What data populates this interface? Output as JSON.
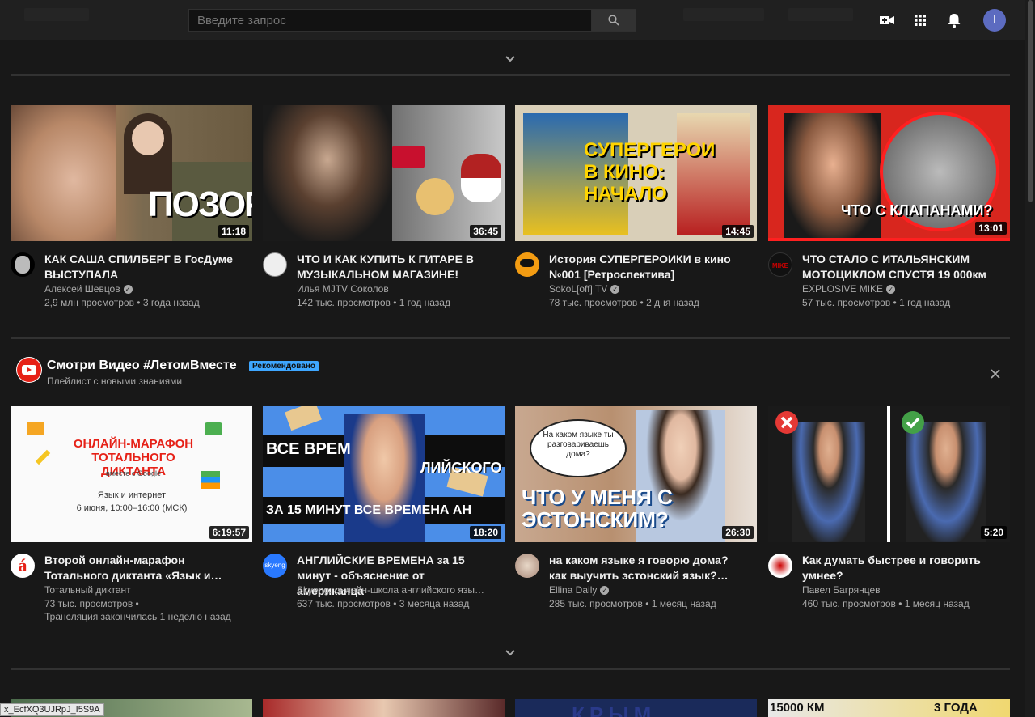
{
  "search": {
    "placeholder": "Введите запрос"
  },
  "avatar_letter": "I",
  "shelf": {
    "title": "Смотри Видео #ЛетомВместе",
    "badge": "Рекомендовано",
    "subtitle": "Плейлист с новыми знаниями"
  },
  "row1": [
    {
      "title": "КАК САША СПИЛБЕРГ В ГосДуме ВЫСТУПАЛА",
      "channel": "Алексей Шевцов",
      "verified": true,
      "stats": "2,9 млн просмотров • 3 года назад",
      "duration": "11:18",
      "overlay": "ПОЗОР"
    },
    {
      "title": "ЧТО И КАК КУПИТЬ К ГИТАРЕ В МУЗЫКАЛЬНОМ МАГАЗИНЕ!",
      "channel": "Илья MJTV Соколов",
      "verified": false,
      "stats": "142 тыс. просмотров • 1 год назад",
      "duration": "36:45",
      "overlay": ""
    },
    {
      "title": "История СУПЕРГЕРОИКИ в кино №001 [Ретроспектива]",
      "channel": "SokoL[off] TV",
      "verified": true,
      "stats": "78 тыс. просмотров • 2 дня назад",
      "duration": "14:45",
      "overlay": "СУПЕРГЕРОИ В КИНО: НАЧАЛО"
    },
    {
      "title": "ЧТО СТАЛО С ИТАЛЬЯНСКИМ МОТОЦИКЛОМ СПУСТЯ 19 000км",
      "channel": "EXPLOSIVE MIKE",
      "verified": true,
      "stats": "57 тыс. просмотров • 1 год назад",
      "duration": "13:01",
      "overlay": "ЧТО С КЛАПАНАМИ?"
    }
  ],
  "row2": [
    {
      "title": "Второй онлайн-марафон Тотального диктанта «Язык и…",
      "channel": "Тотальный диктант",
      "verified": false,
      "stats": "73 тыс. просмотров •",
      "stats2": "Трансляция закончилась 1 неделю назад",
      "duration": "6:19:57",
      "overlay": "ОНЛАЙН-МАРАФОН ТОТАЛЬНОГО ДИКТАНТА",
      "overlay2": "вместе с Google",
      "overlay3": "Язык и интернет",
      "overlay4": "6 июня, 10:00–16:00 (МСК)"
    },
    {
      "title": "АНГЛИЙСКИЕ ВРЕМЕНА за 15 минут - объяснение от американца",
      "channel": "Skyeng: онлайн-школа английского язы…",
      "verified": false,
      "stats": "637 тыс. просмотров • 3 месяца назад",
      "stats2": "",
      "duration": "18:20",
      "overlay": "ВСЕ ВРЕМ",
      "overlay2": "ЛИЙСКОГО",
      "overlay3": "ЗА 15 МИНУТ ВСЕ ВРЕМЕНА АН"
    },
    {
      "title": "на каком языке я говорю дома? как выучить эстонский язык?…",
      "channel": "Ellina Daily",
      "verified": true,
      "stats": "285 тыс. просмотров • 1 месяц назад",
      "stats2": "",
      "duration": "26:30",
      "overlay": "ЧТО У МЕНЯ С ЭСТОНСКИМ?",
      "overlay2": "На каком языке ты разговариваешь дома?"
    },
    {
      "title": "Как думать быстрее и говорить умнее?",
      "channel": "Павел Багрянцев",
      "verified": false,
      "stats": "460 тыс. просмотров • 1 месяц назад",
      "stats2": "",
      "duration": "5:20",
      "overlay": ""
    }
  ],
  "row3_overlays": [
    "",
    "",
    "КРЫМ",
    "15000 КМ",
    "3 ГОДА"
  ],
  "status_tip": "x_EcfXQ3UJRpJ_I5S9A",
  "colors": {
    "background": "#181818",
    "masthead": "#202020",
    "badge": "#3ea6ff",
    "youtube_red": "#ff0000"
  }
}
